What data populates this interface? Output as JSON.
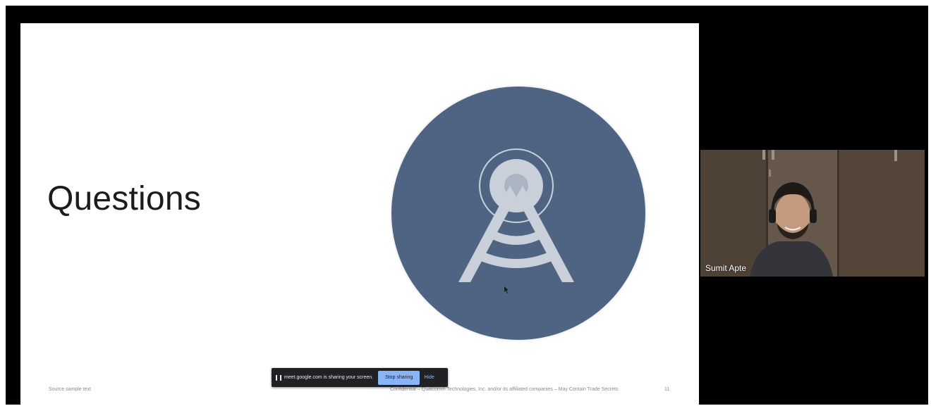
{
  "slide": {
    "title": "Questions",
    "footer_source": "Source sample text",
    "footer_confidential": "Confidential – Qualcomm Technologies, Inc. and/or its affiliated companies – May Contain Trade Secrets",
    "page_number": "11",
    "graphic_icon": "radio-tower-icon"
  },
  "share_bar": {
    "message": "meet.google.com is sharing your screen.",
    "stop_label": "Stop sharing",
    "hide_label": "Hide"
  },
  "participant": {
    "name": "Sumit Apte"
  },
  "colors": {
    "circle": "#4f6482",
    "tower": "#c9d0da",
    "share_bar_bg": "#202124",
    "stop_button": "#8ab4f8"
  }
}
